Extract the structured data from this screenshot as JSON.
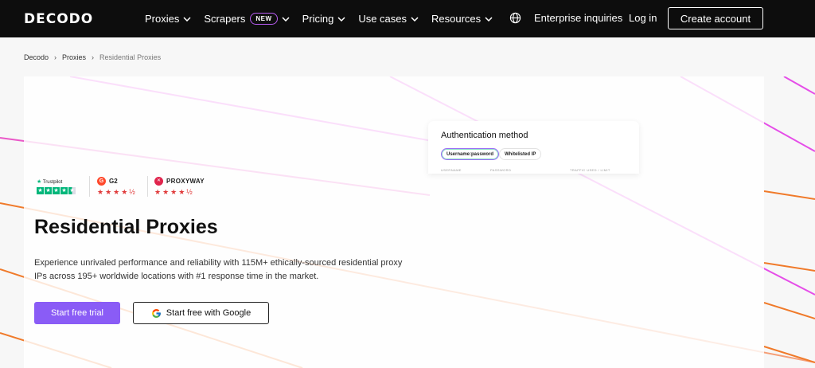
{
  "brand": {
    "logo_text": "DECODO"
  },
  "nav": {
    "items": [
      {
        "label": "Proxies",
        "has_badge": false
      },
      {
        "label": "Scrapers",
        "has_badge": true,
        "badge": "NEW"
      },
      {
        "label": "Pricing",
        "has_badge": false
      },
      {
        "label": "Use cases",
        "has_badge": false
      },
      {
        "label": "Resources",
        "has_badge": false
      }
    ],
    "enterprise": "Enterprise inquiries",
    "login": "Log in",
    "create_account": "Create account"
  },
  "breadcrumb": [
    "Decodo",
    "Proxies",
    "Residential Proxies"
  ],
  "auth_card": {
    "title": "Authentication method",
    "option_selected": "Username:password",
    "option_other": "Whitelisted IP",
    "columns": [
      "USERNAME",
      "PASSWORD",
      "TRAFFIC USED / LIMIT"
    ]
  },
  "ratings": {
    "trustpilot": {
      "name": "Trustpilot",
      "score": 4.5,
      "max": 5
    },
    "g2": {
      "name": "G2",
      "score": 4.5,
      "max": 5
    },
    "proxyway": {
      "name": "PROXYWAY",
      "score": 4.5,
      "max": 5
    }
  },
  "hero": {
    "title": "Residential Proxies",
    "description": "Experience unrivaled performance and reliability with 115M+ ethically-sourced residential proxy IPs across 195+ worldwide locations with #1 response time in the market.",
    "cta_primary": "Start free trial",
    "cta_google": "Start free with Google"
  },
  "colors": {
    "nav_bg": "#0d0d0d",
    "accent": "#8a5cf6",
    "line_pink": "#e54ee8",
    "line_orange": "#f07a2a"
  }
}
